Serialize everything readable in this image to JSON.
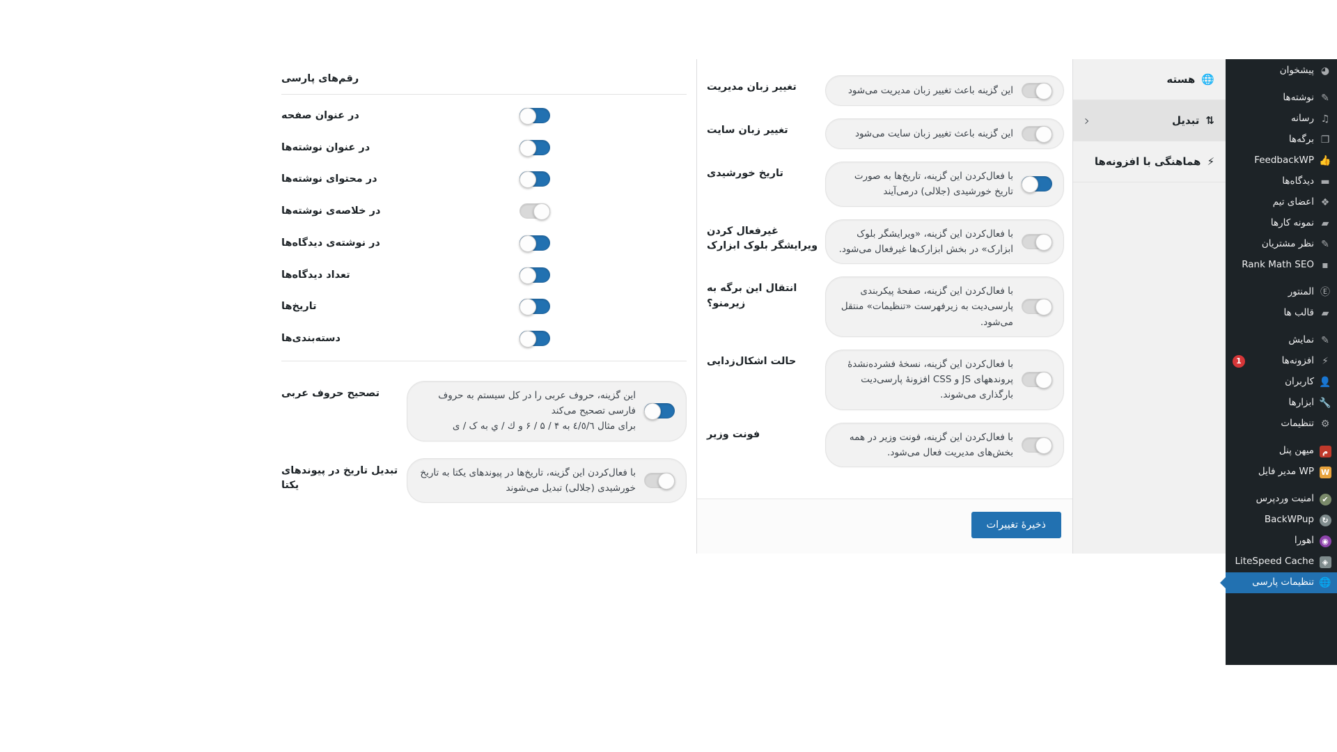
{
  "adminmenu": {
    "items": [
      {
        "label": "پیشخوان",
        "icon": "dashboard-icon",
        "glyph": "◕",
        "sep_after": true
      },
      {
        "label": "نوشته‌ها",
        "icon": "pin-icon",
        "glyph": "✎"
      },
      {
        "label": "رسانه",
        "icon": "media-icon",
        "glyph": "♫"
      },
      {
        "label": "برگه‌ها",
        "icon": "page-icon",
        "glyph": "❐"
      },
      {
        "label": "FeedbackWP",
        "icon": "thumbs-up-icon",
        "glyph": "👍"
      },
      {
        "label": "دیدگاه‌ها",
        "icon": "comment-icon",
        "glyph": "▬"
      },
      {
        "label": "اعضای تیم",
        "icon": "team-icon",
        "glyph": "❖"
      },
      {
        "label": "نمونه کارها",
        "icon": "portfolio-icon",
        "glyph": "▰"
      },
      {
        "label": "نظر مشتریان",
        "icon": "pin-icon",
        "glyph": "✎"
      },
      {
        "label": "Rank Math SEO",
        "icon": "chart-icon",
        "glyph": "▪",
        "sep_after": true
      },
      {
        "label": "المنتور",
        "icon": "elementor-icon",
        "glyph": "Ⓔ"
      },
      {
        "label": "قالب ها",
        "icon": "folder-icon",
        "glyph": "▰",
        "sep_after": true
      },
      {
        "label": "نمایش",
        "icon": "appearance-icon",
        "glyph": "✎"
      },
      {
        "label": "افزونه‌ها",
        "icon": "plugin-icon",
        "glyph": "⚡",
        "badge": "1"
      },
      {
        "label": "کاربران",
        "icon": "users-icon",
        "glyph": "👤"
      },
      {
        "label": "ابزارها",
        "icon": "tools-icon",
        "glyph": "🔧"
      },
      {
        "label": "تنظیمات",
        "icon": "settings-icon",
        "glyph": "⚙",
        "sep_after": true
      },
      {
        "label": "میهن پنل",
        "icon": "mihanpanel-icon",
        "glyph": "م",
        "sqcolor": "#c0392b"
      },
      {
        "label": "WP مدیر فایل",
        "icon": "filemanager-icon",
        "glyph": "W",
        "sqcolor": "#e8a33d",
        "sep_after": true
      },
      {
        "label": "امنیت وردپرس",
        "icon": "shield-icon",
        "glyph": "✔",
        "sqcolor": "#7a8a6a",
        "round": true
      },
      {
        "label": "BackWPup",
        "icon": "backwpup-icon",
        "glyph": "↻",
        "sqcolor": "#7f8c8d",
        "round": true
      },
      {
        "label": "اهورا",
        "icon": "ahoora-icon",
        "glyph": "◉",
        "sqcolor": "#8e44ad",
        "round": true
      },
      {
        "label": "LiteSpeed Cache",
        "icon": "litespeed-icon",
        "glyph": "◈",
        "sqcolor": "#7f8c8d"
      },
      {
        "label": "تنظیمات پارسی",
        "icon": "globe-icon",
        "glyph": "🌐",
        "current": true
      }
    ]
  },
  "subnav": {
    "tabs": [
      {
        "label": "هسته",
        "icon": "globe-icon",
        "glyph": "🌐",
        "active": false,
        "head": true,
        "chevron": "‹"
      },
      {
        "label": "تبدیل",
        "icon": "convert-icon",
        "glyph": "⇅",
        "active": true
      },
      {
        "label": "هماهنگی با افزونه‌ها",
        "icon": "plugin-icon",
        "glyph": "⚡",
        "active": false
      }
    ]
  },
  "subnav_secondary": {
    "tabs": [
      {
        "label": "هسته",
        "icon": "globe-icon",
        "glyph": "🌐",
        "head": true
      },
      {
        "label": "تبدیل",
        "icon": "convert-icon",
        "glyph": "⇅",
        "active": true,
        "chevron": "‹"
      },
      {
        "label": "هماهنگی با افزونه‌ها",
        "icon": "plugin-icon",
        "glyph": "⚡"
      }
    ]
  },
  "main_panel": {
    "fields": [
      {
        "title": "تغییر زبان مدیریت",
        "description": "این گزینه باعث تغییر زبان مدیریت می‌شود",
        "toggle_on": false
      },
      {
        "title": "تغییر زبان سایت",
        "description": "این گزینه باعث تغییر زبان سایت می‌شود",
        "toggle_on": false
      },
      {
        "title": "تاریخ خورشیدی",
        "description": "با فعال‌کردن این گزینه، تاریخ‌ها به صورت تاریخ خورشیدی (جلالی) درمی‌آیند",
        "toggle_on": true
      },
      {
        "title": "غیرفعال کردن ویرایشگر بلوک ابزارک",
        "description": "با فعال‌کردن این گزینه، «ویرایشگر بلوک ابزارک» در بخش ابزارک‌ها غیرفعال می‌شود.",
        "toggle_on": false
      },
      {
        "title": "انتقال این برگه به زیرمنو؟",
        "description": "با فعال‌کردن این گزینه، صفحهٔ پیکربندی پارسی‌دیت به زیرفهرست «تنظیمات» منتقل می‌شود.",
        "toggle_on": false
      },
      {
        "title": "حالت اشکال‌زدایی",
        "description": "با فعال‌کردن این گزینه، نسخهٔ فشرده‌نشدهٔ پروندههای JS و CSS افزونهٔ پارسی‌دیت بارگذاری می‌شوند.",
        "toggle_on": false
      },
      {
        "title": "فونت وزیر",
        "description": "با فعال‌کردن این گزینه، فونت وزیر در همه بخش‌های مدیریت فعال می‌شود.",
        "toggle_on": false
      }
    ],
    "save_label": "ذخیرهٔ تغییرات"
  },
  "left_panel": {
    "section_title": "رقم‌های پارسی",
    "simple_rows": [
      {
        "title": "در عنوان صفحه",
        "toggle_on": true
      },
      {
        "title": "در عنوان نوشته‌ها",
        "toggle_on": true
      },
      {
        "title": "در محتوای نوشته‌ها",
        "toggle_on": true
      },
      {
        "title": "در خلاصه‌ی نوشته‌ها",
        "toggle_on": false
      },
      {
        "title": "در نوشته‌ی دیدگاه‌ها",
        "toggle_on": true
      },
      {
        "title": "تعداد دیدگاه‌ها",
        "toggle_on": true
      },
      {
        "title": "تاریخ‌ها",
        "toggle_on": true
      },
      {
        "title": "دسته‌بندی‌ها",
        "toggle_on": true
      }
    ],
    "desc_rows": [
      {
        "title": "تصحیح حروف عربی",
        "description": "این گزینه، حروف عربی را در کل سیستم به حروف فارسی تصحیح می‌کند\nبرای مثال ٤/٥/٦ به ۴ / ۵ / ۶ و ك / ي به ک / ی",
        "toggle_on": true
      },
      {
        "title": "تبدیل تاریخ در پیوندهای یکتا",
        "description": "با فعال‌کردن این گزینه، تاریخ‌ها در پیوندهای یکتا به تاریخ خورشیدی (جلالی) تبدیل می‌شوند",
        "toggle_on": false
      }
    ]
  },
  "colors": {
    "accent": "#2271b1",
    "sidebar_bg": "#1d2327",
    "badge": "#d63638",
    "panel_bg": "#ffffff",
    "subnav_bg": "#f1f1f1"
  }
}
